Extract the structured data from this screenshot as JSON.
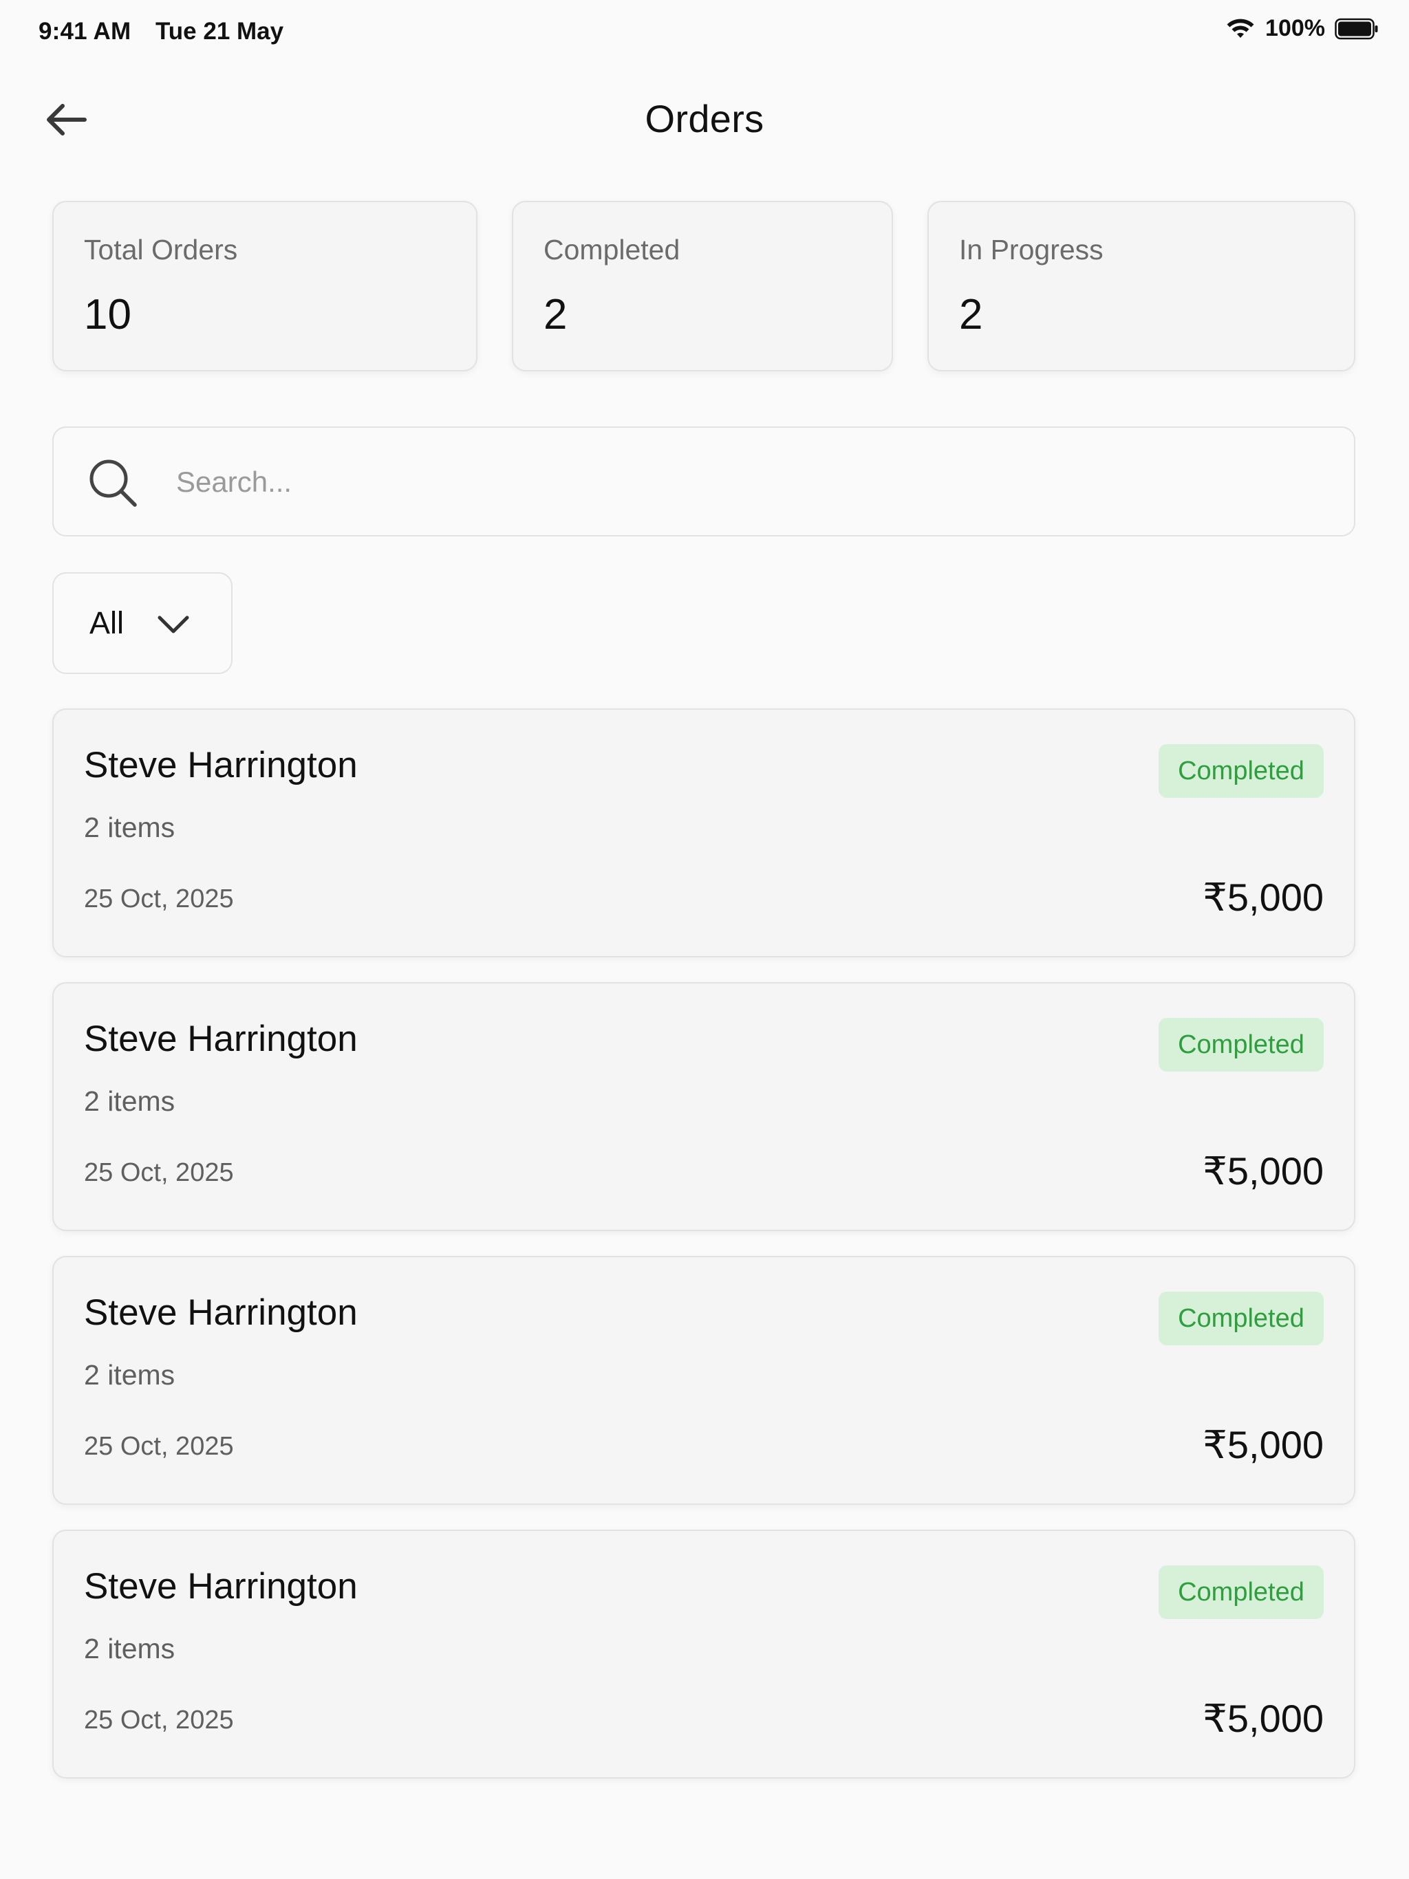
{
  "status_bar": {
    "time": "9:41 AM",
    "date": "Tue 21 May",
    "battery": "100%"
  },
  "header": {
    "title": "Orders",
    "back_icon": "arrow-left-icon"
  },
  "stats": [
    {
      "label": "Total Orders",
      "value": "10"
    },
    {
      "label": "Completed",
      "value": "2"
    },
    {
      "label": "In Progress",
      "value": "2"
    }
  ],
  "search": {
    "placeholder": "Search...",
    "value": ""
  },
  "filter": {
    "selected": "All"
  },
  "orders": [
    {
      "customer": "Steve Harrington",
      "items": "2 items",
      "date": "25 Oct, 2025",
      "amount": "₹5,000",
      "status": "Completed"
    },
    {
      "customer": "Steve Harrington",
      "items": "2 items",
      "date": "25 Oct, 2025",
      "amount": "₹5,000",
      "status": "Completed"
    },
    {
      "customer": "Steve Harrington",
      "items": "2 items",
      "date": "25 Oct, 2025",
      "amount": "₹5,000",
      "status": "Completed"
    },
    {
      "customer": "Steve Harrington",
      "items": "2 items",
      "date": "25 Oct, 2025",
      "amount": "₹5,000",
      "status": "Completed"
    }
  ],
  "colors": {
    "badge_bg": "#d7f1d9",
    "badge_text": "#2e9e3e",
    "card_bg": "#f5f5f5",
    "border": "#e2e2e2",
    "page_bg": "#fafafa"
  }
}
